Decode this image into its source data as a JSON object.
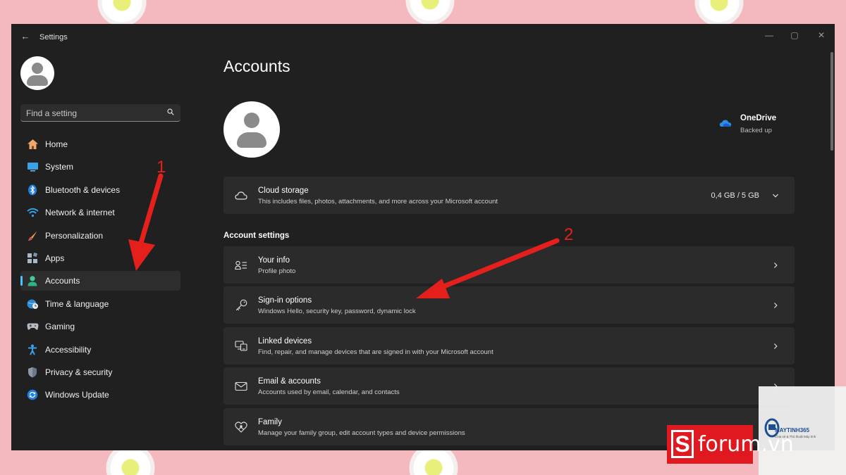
{
  "window": {
    "title": "Settings",
    "controls": {
      "minimize": "—",
      "maximize": "▢",
      "close": "✕"
    }
  },
  "sidebar": {
    "search_placeholder": "Find a setting",
    "items": [
      {
        "label": "Home",
        "icon": "home-icon"
      },
      {
        "label": "System",
        "icon": "system-icon"
      },
      {
        "label": "Bluetooth & devices",
        "icon": "bluetooth-icon"
      },
      {
        "label": "Network & internet",
        "icon": "wifi-icon"
      },
      {
        "label": "Personalization",
        "icon": "brush-icon"
      },
      {
        "label": "Apps",
        "icon": "apps-icon"
      },
      {
        "label": "Accounts",
        "icon": "account-icon",
        "active": true
      },
      {
        "label": "Time & language",
        "icon": "globe-clock-icon"
      },
      {
        "label": "Gaming",
        "icon": "gamepad-icon"
      },
      {
        "label": "Accessibility",
        "icon": "accessibility-icon"
      },
      {
        "label": "Privacy & security",
        "icon": "shield-icon"
      },
      {
        "label": "Windows Update",
        "icon": "update-icon"
      }
    ]
  },
  "main": {
    "title": "Accounts",
    "onedrive": {
      "name": "OneDrive",
      "status": "Backed up"
    },
    "cloud_storage": {
      "title": "Cloud storage",
      "subtitle": "This includes files, photos, attachments, and more across your Microsoft account",
      "value": "0,4 GB / 5 GB"
    },
    "section_label": "Account settings",
    "settings": [
      {
        "title": "Your info",
        "subtitle": "Profile photo",
        "icon": "person-details-icon"
      },
      {
        "title": "Sign-in options",
        "subtitle": "Windows Hello, security key, password, dynamic lock",
        "icon": "key-icon"
      },
      {
        "title": "Linked devices",
        "subtitle": "Find, repair, and manage devices that are signed in with your Microsoft account",
        "icon": "devices-icon"
      },
      {
        "title": "Email & accounts",
        "subtitle": "Accounts used by email, calendar, and contacts",
        "icon": "mail-icon"
      },
      {
        "title": "Family",
        "subtitle": "Manage your family group, edit account types and device permissions",
        "icon": "family-heart-icon"
      }
    ]
  },
  "annotations": {
    "step1": "1",
    "step2": "2",
    "color": "#e5201c"
  },
  "watermarks": {
    "maytinh": "MAYTINH365",
    "maytinh_sub": "Chia sẻ & Thủ thuật Máy tính",
    "sforum_letter": "S",
    "sforum": "forum.vn"
  },
  "colors": {
    "accent": "#4cc2ff",
    "window_bg": "#202020",
    "card_bg": "#2b2b2b",
    "brand_red": "#e0181f"
  }
}
